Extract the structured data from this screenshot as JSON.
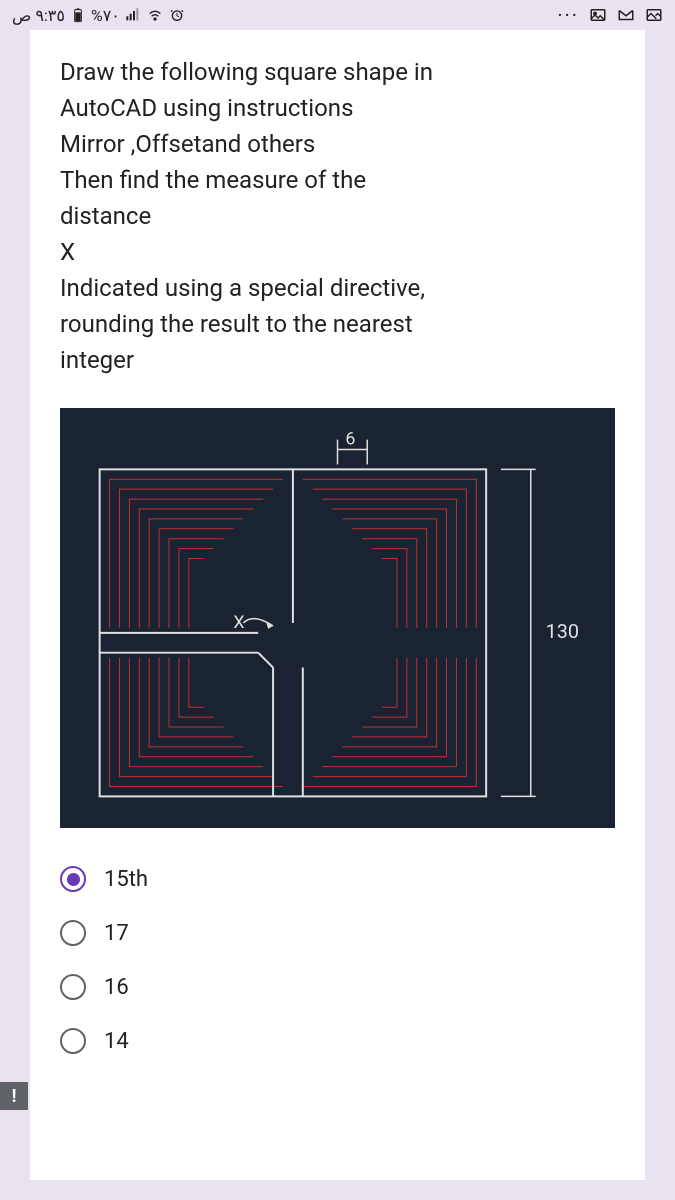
{
  "statusBar": {
    "time": "٩:٣٥ ص",
    "battery": "%٧٠",
    "dots": "···"
  },
  "question": {
    "line1": "Draw the following square shape in",
    "line2": " AutoCAD using instructions",
    "line3": "Mirror ,Offsetand others",
    "line4": " Then find the measure of the",
    "line5": "distance",
    "line6": "X",
    "line7": " Indicated using a special directive,",
    "line8": "rounding the result to the nearest",
    "line9": " integer"
  },
  "diagram": {
    "dimTop": "6",
    "dimRight": "130",
    "labelX": "X"
  },
  "options": [
    {
      "label": "15th",
      "selected": true
    },
    {
      "label": "17",
      "selected": false
    },
    {
      "label": "16",
      "selected": false
    },
    {
      "label": "14",
      "selected": false
    }
  ],
  "feedbackIcon": "!"
}
